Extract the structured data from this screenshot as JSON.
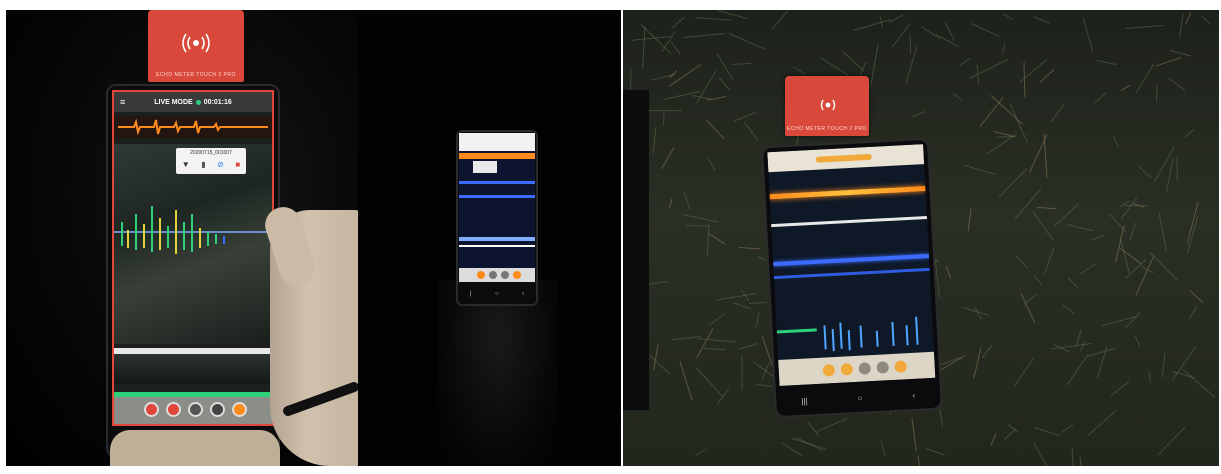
{
  "panel1": {
    "device_label": "ECHO METER TOUCH 2 PRO",
    "app_header": "LIVE MODE",
    "timer": "00:01:16",
    "file_label": "20200715_001007"
  },
  "panel2": {},
  "panel3": {
    "device_label": "ECHO METER TOUCH 2 PRO"
  },
  "colors": {
    "accent_red": "#e0473a",
    "wave_orange": "#ff8a1c",
    "wave_blue": "#3b6cff",
    "call_green": "#2fd07a",
    "grass": "#2a2f24"
  }
}
